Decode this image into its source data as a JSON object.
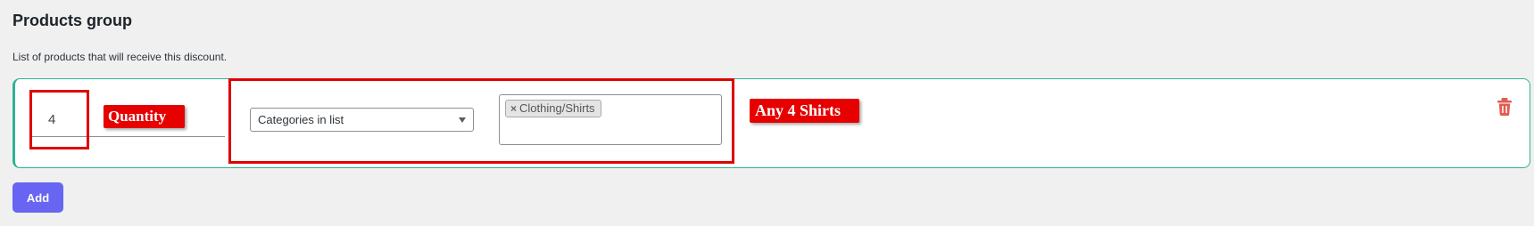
{
  "section": {
    "title": "Products group",
    "description": "List of products that will receive this discount."
  },
  "group": {
    "quantity_value": "4",
    "filter_select": {
      "selected": "Categories in list"
    },
    "tags": [
      {
        "remove": "×",
        "label": "Clothing/Shirts"
      }
    ]
  },
  "annotations": {
    "quantity_callout": "Quantity",
    "any_callout": "Any 4 Shirts"
  },
  "actions": {
    "add_label": "Add"
  },
  "icons": {
    "select_arrow": "chevron-down-icon",
    "delete": "trash-icon"
  },
  "colors": {
    "accent": "#6765f2",
    "row_border": "#2db394",
    "highlight": "#e00000",
    "delete_icon": "#e05d52"
  }
}
